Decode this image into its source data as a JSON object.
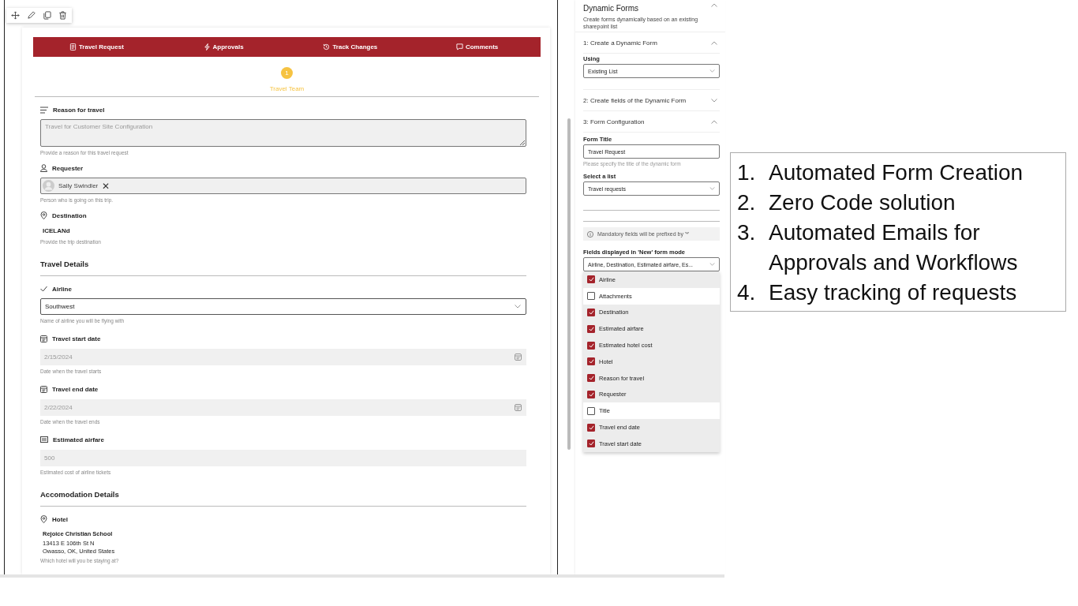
{
  "form": {
    "tabs": [
      {
        "label": "Travel Request"
      },
      {
        "label": "Approvals"
      },
      {
        "label": "Track Changes"
      },
      {
        "label": "Comments"
      }
    ],
    "step": {
      "number": "1",
      "label": "Travel Team"
    },
    "items": [
      {
        "kind": "textarea",
        "label": "Reason for travel",
        "value": "Travel for Customer Site Configuration",
        "hint": "Provide a reason for this travel request"
      },
      {
        "kind": "people",
        "label": "Requester",
        "value": "Sally Swindler",
        "remove": "✕",
        "hint": "Person who is going on this trip."
      },
      {
        "kind": "location",
        "label": "Destination",
        "value": "ICELANd",
        "hint": "Provide the trip destination"
      },
      {
        "kind": "heading",
        "label": "Travel Details"
      },
      {
        "kind": "dropdown",
        "label": "Airline",
        "value": "Southwest",
        "hint": "Name of airline you will be flying with"
      },
      {
        "kind": "date",
        "label": "Travel start date",
        "value": "2/15/2024",
        "hint": "Date when the travel starts"
      },
      {
        "kind": "date",
        "label": "Travel end date",
        "value": "2/22/2024",
        "hint": "Date when the travel ends"
      },
      {
        "kind": "number",
        "label": "Estimated airfare",
        "value": "500",
        "hint": "Estimated cost of airline tickets"
      },
      {
        "kind": "heading",
        "label": "Accomodation Details"
      },
      {
        "kind": "address",
        "label": "Hotel",
        "value": "Rejoice Christian School",
        "lines": [
          "13413 E 106th St N",
          "Owasso, OK, United States"
        ],
        "hint": "Which hotel will you be staying at?"
      }
    ]
  },
  "panel": {
    "title": "Dynamic Forms",
    "description": "Create forms dynamically based on an existing sharepoint list",
    "sections": [
      {
        "title": "1: Create a Dynamic Form",
        "expanded": true
      },
      {
        "title": "2: Create fields of the Dynamic Form",
        "expanded": false
      },
      {
        "title": "3: Form Configuration",
        "expanded": true
      }
    ],
    "using": {
      "label": "Using",
      "value": "Existing List"
    },
    "form_title": {
      "label": "Form Title",
      "value": "Travel Request",
      "hint": "Please specify the title of the dynamic form"
    },
    "select_list": {
      "label": "Select a list",
      "value": "Travel requests"
    },
    "info": "Mandatory fields will be prefixed by '*'",
    "fields": {
      "label": "Fields displayed in 'New' form mode",
      "value": "Airline, Destination, Estimated airfare, Es...",
      "options": [
        {
          "label": "Airline",
          "checked": true
        },
        {
          "label": "Attachments",
          "checked": false
        },
        {
          "label": "Destination",
          "checked": true
        },
        {
          "label": "Estimated airfare",
          "checked": true
        },
        {
          "label": "Estimated hotel cost",
          "checked": true
        },
        {
          "label": "Hotel",
          "checked": true
        },
        {
          "label": "Reason for travel",
          "checked": true
        },
        {
          "label": "Requester",
          "checked": true
        },
        {
          "label": "Title",
          "checked": false
        },
        {
          "label": "Travel end date",
          "checked": true
        },
        {
          "label": "Travel start date",
          "checked": true
        }
      ]
    }
  },
  "features": [
    {
      "number": "1.",
      "text": "Automated Form Creation"
    },
    {
      "number": "2.",
      "text": "Zero Code solution"
    },
    {
      "number": "3.",
      "text": "Automated Emails for Approvals and Workflows"
    },
    {
      "number": "4.",
      "text": "Easy tracking of requests"
    }
  ]
}
